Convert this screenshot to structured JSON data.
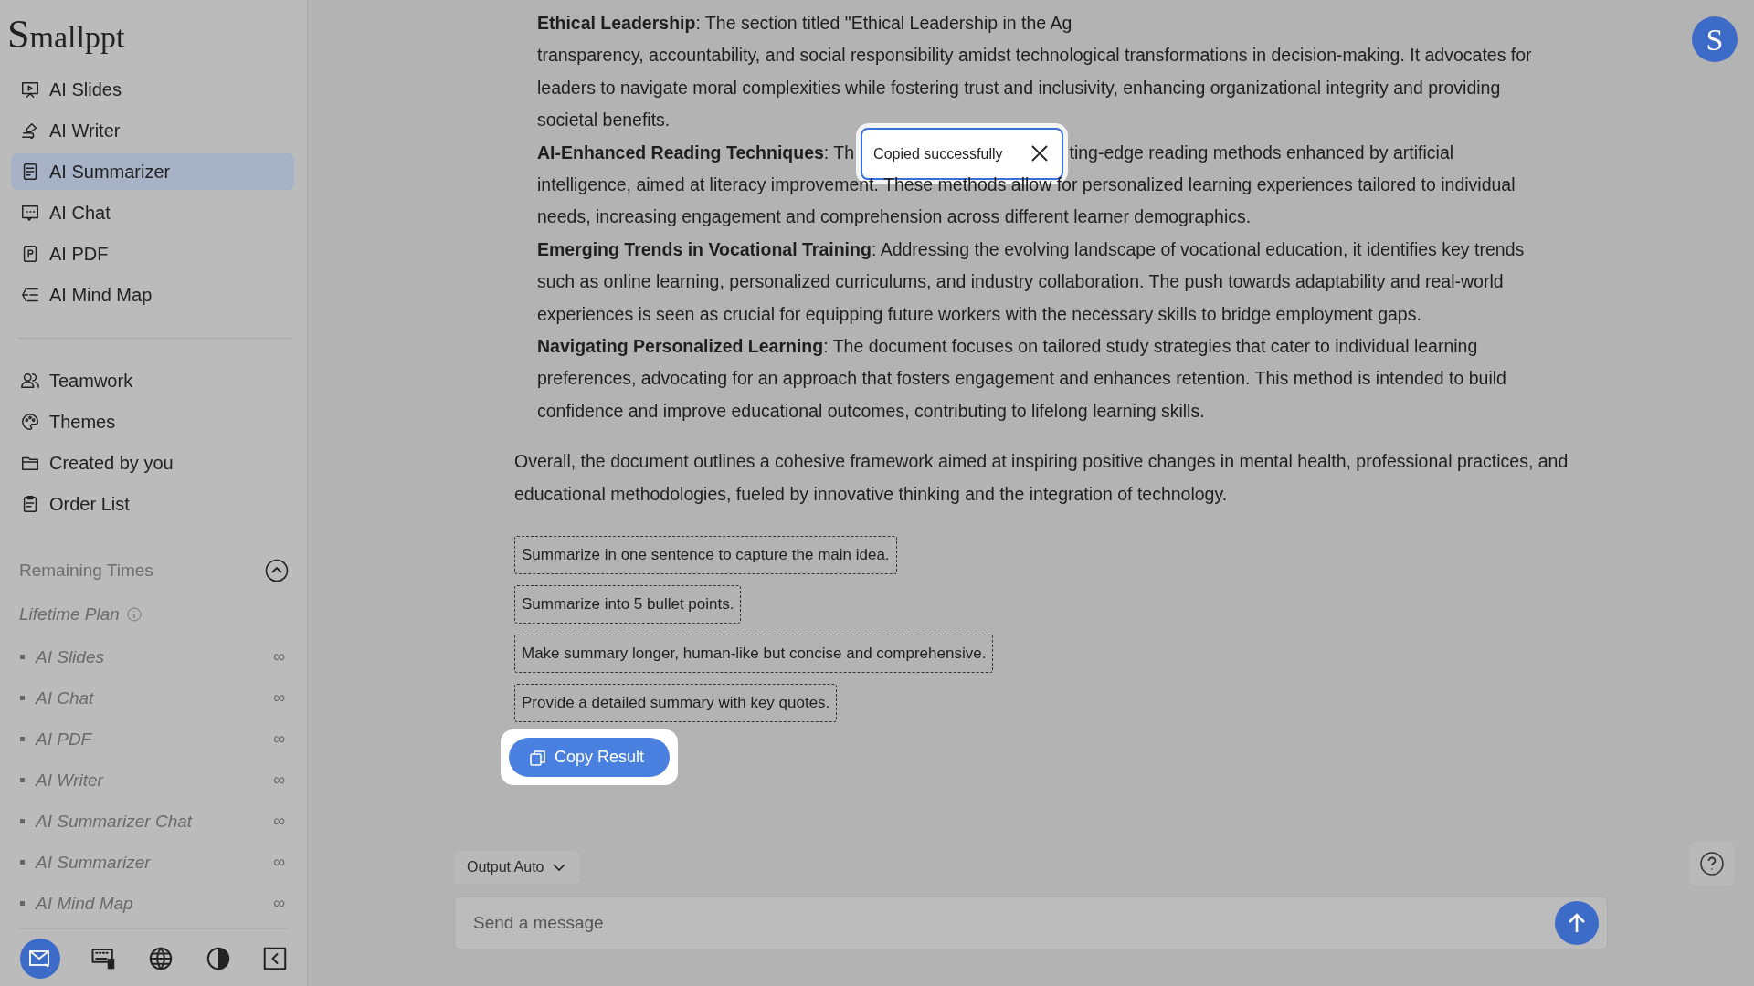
{
  "sidebar": {
    "logo": "Smallppt",
    "tools": [
      {
        "label": "AI Slides",
        "selected": false
      },
      {
        "label": "AI Writer",
        "selected": false
      },
      {
        "label": "AI Summarizer",
        "selected": true
      },
      {
        "label": "AI Chat",
        "selected": false
      },
      {
        "label": "AI PDF",
        "selected": false
      },
      {
        "label": "AI Mind Map",
        "selected": false
      }
    ],
    "links": [
      {
        "label": "Teamwork"
      },
      {
        "label": "Themes"
      },
      {
        "label": "Created by you"
      },
      {
        "label": "Order List"
      }
    ],
    "remaining": {
      "title": "Remaining Times",
      "expanded": true,
      "plan": "Lifetime Plan",
      "items": [
        {
          "label": "AI Slides",
          "count": "∞"
        },
        {
          "label": "AI Chat",
          "count": "∞"
        },
        {
          "label": "AI PDF",
          "count": "∞"
        },
        {
          "label": "AI Writer",
          "count": "∞"
        },
        {
          "label": "AI Summarizer Chat",
          "count": "∞"
        },
        {
          "label": "AI Summarizer",
          "count": "∞"
        },
        {
          "label": "AI Mind Map",
          "count": "∞"
        }
      ]
    }
  },
  "avatar": {
    "letter": "S"
  },
  "result": {
    "lines": [
      {
        "kind": "text",
        "text": "**Ethical Leadership**: The section titled \"Ethical Leadership in the Ag"
      },
      {
        "kind": "text",
        "text": "transparency, accountability, and social responsibility amidst technological transformations in decision-making. It advocates for"
      },
      {
        "kind": "text",
        "text": "leaders to navigate moral complexities while fostering trust and inclusivity, enhancing organizational integrity and providing"
      },
      {
        "kind": "text",
        "text": "societal benefits."
      },
      {
        "kind": "split",
        "before": "**AI-Enhanced Reading Techniques**: Th",
        "after": "ting-edge reading methods enhanced by artificial"
      },
      {
        "kind": "text",
        "text": "intelligence, aimed at literacy improvement. These methods allow for personalized learning experiences tailored to individual"
      },
      {
        "kind": "text",
        "text": "needs, increasing engagement and comprehension across different learner demographics."
      },
      {
        "kind": "text",
        "text": "**Emerging Trends in Vocational Training**: Addressing the evolving landscape of vocational education, it identifies key trends"
      },
      {
        "kind": "text",
        "text": "such as online learning, personalized curriculums, and industry collaboration. The push towards adaptability and real-world"
      },
      {
        "kind": "text",
        "text": "experiences is seen as crucial for equipping future workers with the necessary skills to bridge employment gaps."
      },
      {
        "kind": "text",
        "text": "**Navigating Personalized Learning**: The document focuses on tailored study strategies that cater to individual learning"
      },
      {
        "kind": "text",
        "text": "preferences, advocating for an approach that fosters engagement and enhances retention. This method is intended to build"
      },
      {
        "kind": "text",
        "text": "confidence and improve educational outcomes, contributing to lifelong learning skills."
      }
    ],
    "conclusion": "Overall, the document outlines a cohesive framework aimed at inspiring positive changes in mental health, professional practices, and educational methodologies, fueled by innovative thinking and the integration of technology.",
    "suggestions": [
      "Summarize in one sentence to capture the main idea.",
      "Summarize into 5 bullet points.",
      "Make summary longer, human-like but concise and comprehensive.",
      "Provide a detailed summary with key quotes."
    ],
    "copy_button": "Copy Result"
  },
  "toast": {
    "message": "Copied successfully"
  },
  "composer": {
    "output": "Output Auto",
    "placeholder": "Send a message"
  }
}
